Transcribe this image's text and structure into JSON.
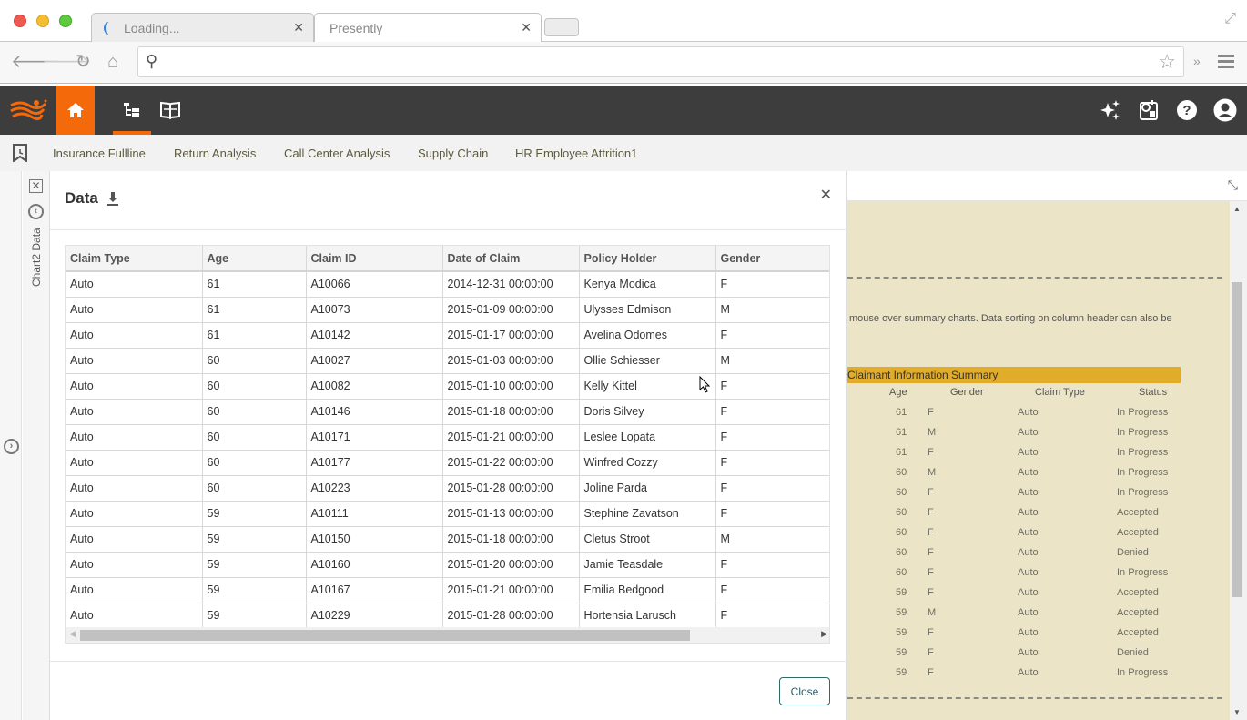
{
  "browser": {
    "tabs": [
      {
        "label": "Loading...",
        "state": "loading"
      },
      {
        "label": "Presently",
        "state": "active"
      }
    ],
    "address": {
      "value": "",
      "placeholder": ""
    }
  },
  "appbar": {
    "brand_color": "#f46a0b",
    "icons_left": [
      "logo-icon",
      "home-icon",
      "hierarchy-icon",
      "book-icon"
    ],
    "icons_right": [
      "sparkle-icon",
      "schedule-icon",
      "help-icon",
      "account-icon"
    ]
  },
  "bookmarks": {
    "items": [
      {
        "label": "Insurance Fullline"
      },
      {
        "label": "Return Analysis"
      },
      {
        "label": "Call Center Analysis"
      },
      {
        "label": "Supply Chain"
      },
      {
        "label": "HR Employee Attrition1"
      }
    ]
  },
  "rail": {
    "label": "Chart2 Data"
  },
  "dialog": {
    "title": "Data",
    "close_label": "Close",
    "columns": [
      "Claim Type",
      "Age",
      "Claim ID",
      "Date of Claim",
      "Policy Holder",
      "Gender"
    ],
    "rows": [
      [
        "Auto",
        "61",
        "A10066",
        "2014-12-31 00:00:00",
        "Kenya Modica",
        "F"
      ],
      [
        "Auto",
        "61",
        "A10073",
        "2015-01-09 00:00:00",
        "Ulysses Edmison",
        "M"
      ],
      [
        "Auto",
        "61",
        "A10142",
        "2015-01-17 00:00:00",
        "Avelina Odomes",
        "F"
      ],
      [
        "Auto",
        "60",
        "A10027",
        "2015-01-03 00:00:00",
        "Ollie Schiesser",
        "M"
      ],
      [
        "Auto",
        "60",
        "A10082",
        "2015-01-10 00:00:00",
        "Kelly Kittel",
        "F"
      ],
      [
        "Auto",
        "60",
        "A10146",
        "2015-01-18 00:00:00",
        "Doris Silvey",
        "F"
      ],
      [
        "Auto",
        "60",
        "A10171",
        "2015-01-21 00:00:00",
        "Leslee Lopata",
        "F"
      ],
      [
        "Auto",
        "60",
        "A10177",
        "2015-01-22 00:00:00",
        "Winfred Cozzy",
        "F"
      ],
      [
        "Auto",
        "60",
        "A10223",
        "2015-01-28 00:00:00",
        "Joline Parda",
        "F"
      ],
      [
        "Auto",
        "59",
        "A10111",
        "2015-01-13 00:00:00",
        "Stephine Zavatson",
        "F"
      ],
      [
        "Auto",
        "59",
        "A10150",
        "2015-01-18 00:00:00",
        "Cletus Stroot",
        "M"
      ],
      [
        "Auto",
        "59",
        "A10160",
        "2015-01-20 00:00:00",
        "Jamie Teasdale",
        "F"
      ],
      [
        "Auto",
        "59",
        "A10167",
        "2015-01-21 00:00:00",
        "Emilia Bedgood",
        "F"
      ],
      [
        "Auto",
        "59",
        "A10229",
        "2015-01-28 00:00:00",
        "Hortensia Larusch",
        "F"
      ]
    ]
  },
  "background": {
    "note": "mouse over summary charts. Data sorting on column header can also be",
    "summary_title": "Claimant Information Summary",
    "summary_color": "#e0ac2a",
    "columns": [
      "Age",
      "Gender",
      "Claim Type",
      "Status"
    ],
    "rows": [
      [
        "61",
        "F",
        "Auto",
        "In Progress"
      ],
      [
        "61",
        "M",
        "Auto",
        "In Progress"
      ],
      [
        "61",
        "F",
        "Auto",
        "In Progress"
      ],
      [
        "60",
        "M",
        "Auto",
        "In Progress"
      ],
      [
        "60",
        "F",
        "Auto",
        "In Progress"
      ],
      [
        "60",
        "F",
        "Auto",
        "Accepted"
      ],
      [
        "60",
        "F",
        "Auto",
        "Accepted"
      ],
      [
        "60",
        "F",
        "Auto",
        "Denied"
      ],
      [
        "60",
        "F",
        "Auto",
        "In Progress"
      ],
      [
        "59",
        "F",
        "Auto",
        "Accepted"
      ],
      [
        "59",
        "M",
        "Auto",
        "Accepted"
      ],
      [
        "59",
        "F",
        "Auto",
        "Accepted"
      ],
      [
        "59",
        "F",
        "Auto",
        "Denied"
      ],
      [
        "59",
        "F",
        "Auto",
        "In Progress"
      ]
    ]
  }
}
